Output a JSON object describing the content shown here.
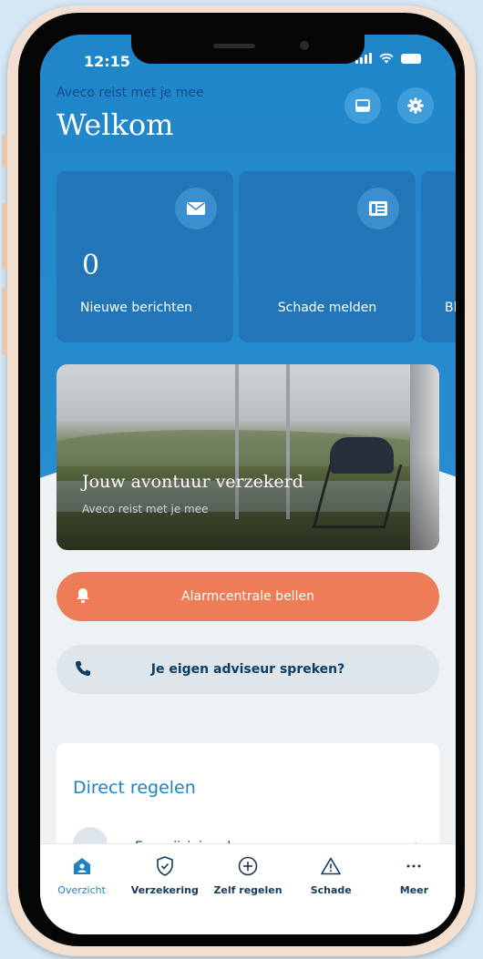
{
  "status_bar": {
    "time": "12:15"
  },
  "header": {
    "subtitle": "Aveco reist met je mee",
    "title": "Welkom",
    "inbox_icon": "inbox-icon",
    "settings_icon": "gear-icon"
  },
  "cards": [
    {
      "count": "0",
      "label": "Nieuwe berichten",
      "icon": "envelope-icon"
    },
    {
      "count": "",
      "label": "Schade melden",
      "icon": "form-icon"
    },
    {
      "count": "",
      "label": "Bl",
      "icon": ""
    }
  ],
  "promo": {
    "title": "Jouw avontuur verzekerd",
    "subtitle": "Aveco reist met je mee"
  },
  "alarm_button": {
    "label": "Alarmcentrale bellen",
    "icon": "bell-icon"
  },
  "advisor_button": {
    "label": "Je eigen adviseur spreken?",
    "icon": "phone-icon"
  },
  "direct": {
    "title": "Direct regelen",
    "items": [
      {
        "label": "Een wijziging doorgeven"
      }
    ]
  },
  "tabbar": [
    {
      "label": "Overzicht",
      "icon": "home-user-icon",
      "active": true
    },
    {
      "label": "Verzekering",
      "icon": "shield-check-icon",
      "active": false
    },
    {
      "label": "Zelf regelen",
      "icon": "plus-circle-icon",
      "active": false
    },
    {
      "label": "Schade",
      "icon": "warning-icon",
      "active": false
    },
    {
      "label": "Meer",
      "icon": "more-icon",
      "active": false
    }
  ],
  "colors": {
    "primary": "#1f85c9",
    "card": "#2275b6",
    "alarm": "#ee7c57",
    "active_tab": "#1e82c6"
  }
}
